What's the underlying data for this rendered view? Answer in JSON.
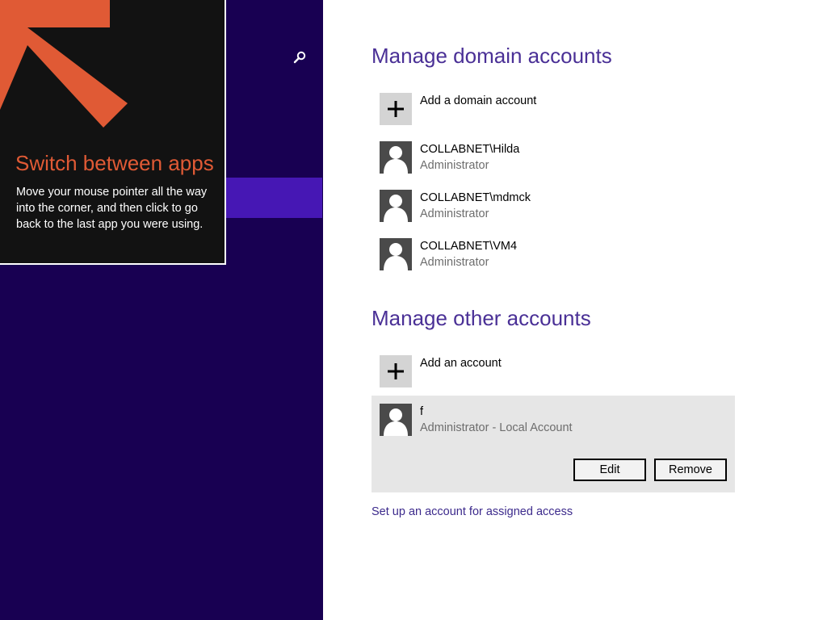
{
  "tip": {
    "title": "Switch between apps",
    "body": "Move your mouse pointer all the way into the corner, and then click to go back to the last app you were using."
  },
  "search": {
    "icon": "search-icon"
  },
  "domain_section": {
    "title": "Manage domain accounts",
    "add_label": "Add a domain account",
    "accounts": [
      {
        "name": "COLLABNET\\Hilda",
        "role": "Administrator"
      },
      {
        "name": "COLLABNET\\mdmck",
        "role": "Administrator"
      },
      {
        "name": "COLLABNET\\VM4",
        "role": "Administrator"
      }
    ]
  },
  "other_section": {
    "title": "Manage other accounts",
    "add_label": "Add an account",
    "selected_account": {
      "name": "f",
      "role": "Administrator - Local Account",
      "edit_label": "Edit",
      "remove_label": "Remove"
    }
  },
  "assigned_access_link": "Set up an account for assigned access",
  "colors": {
    "left_pane": "#180052",
    "selected_nav": "#4617b4",
    "accent_title": "#4a3096",
    "tip_title": "#e05a35"
  }
}
